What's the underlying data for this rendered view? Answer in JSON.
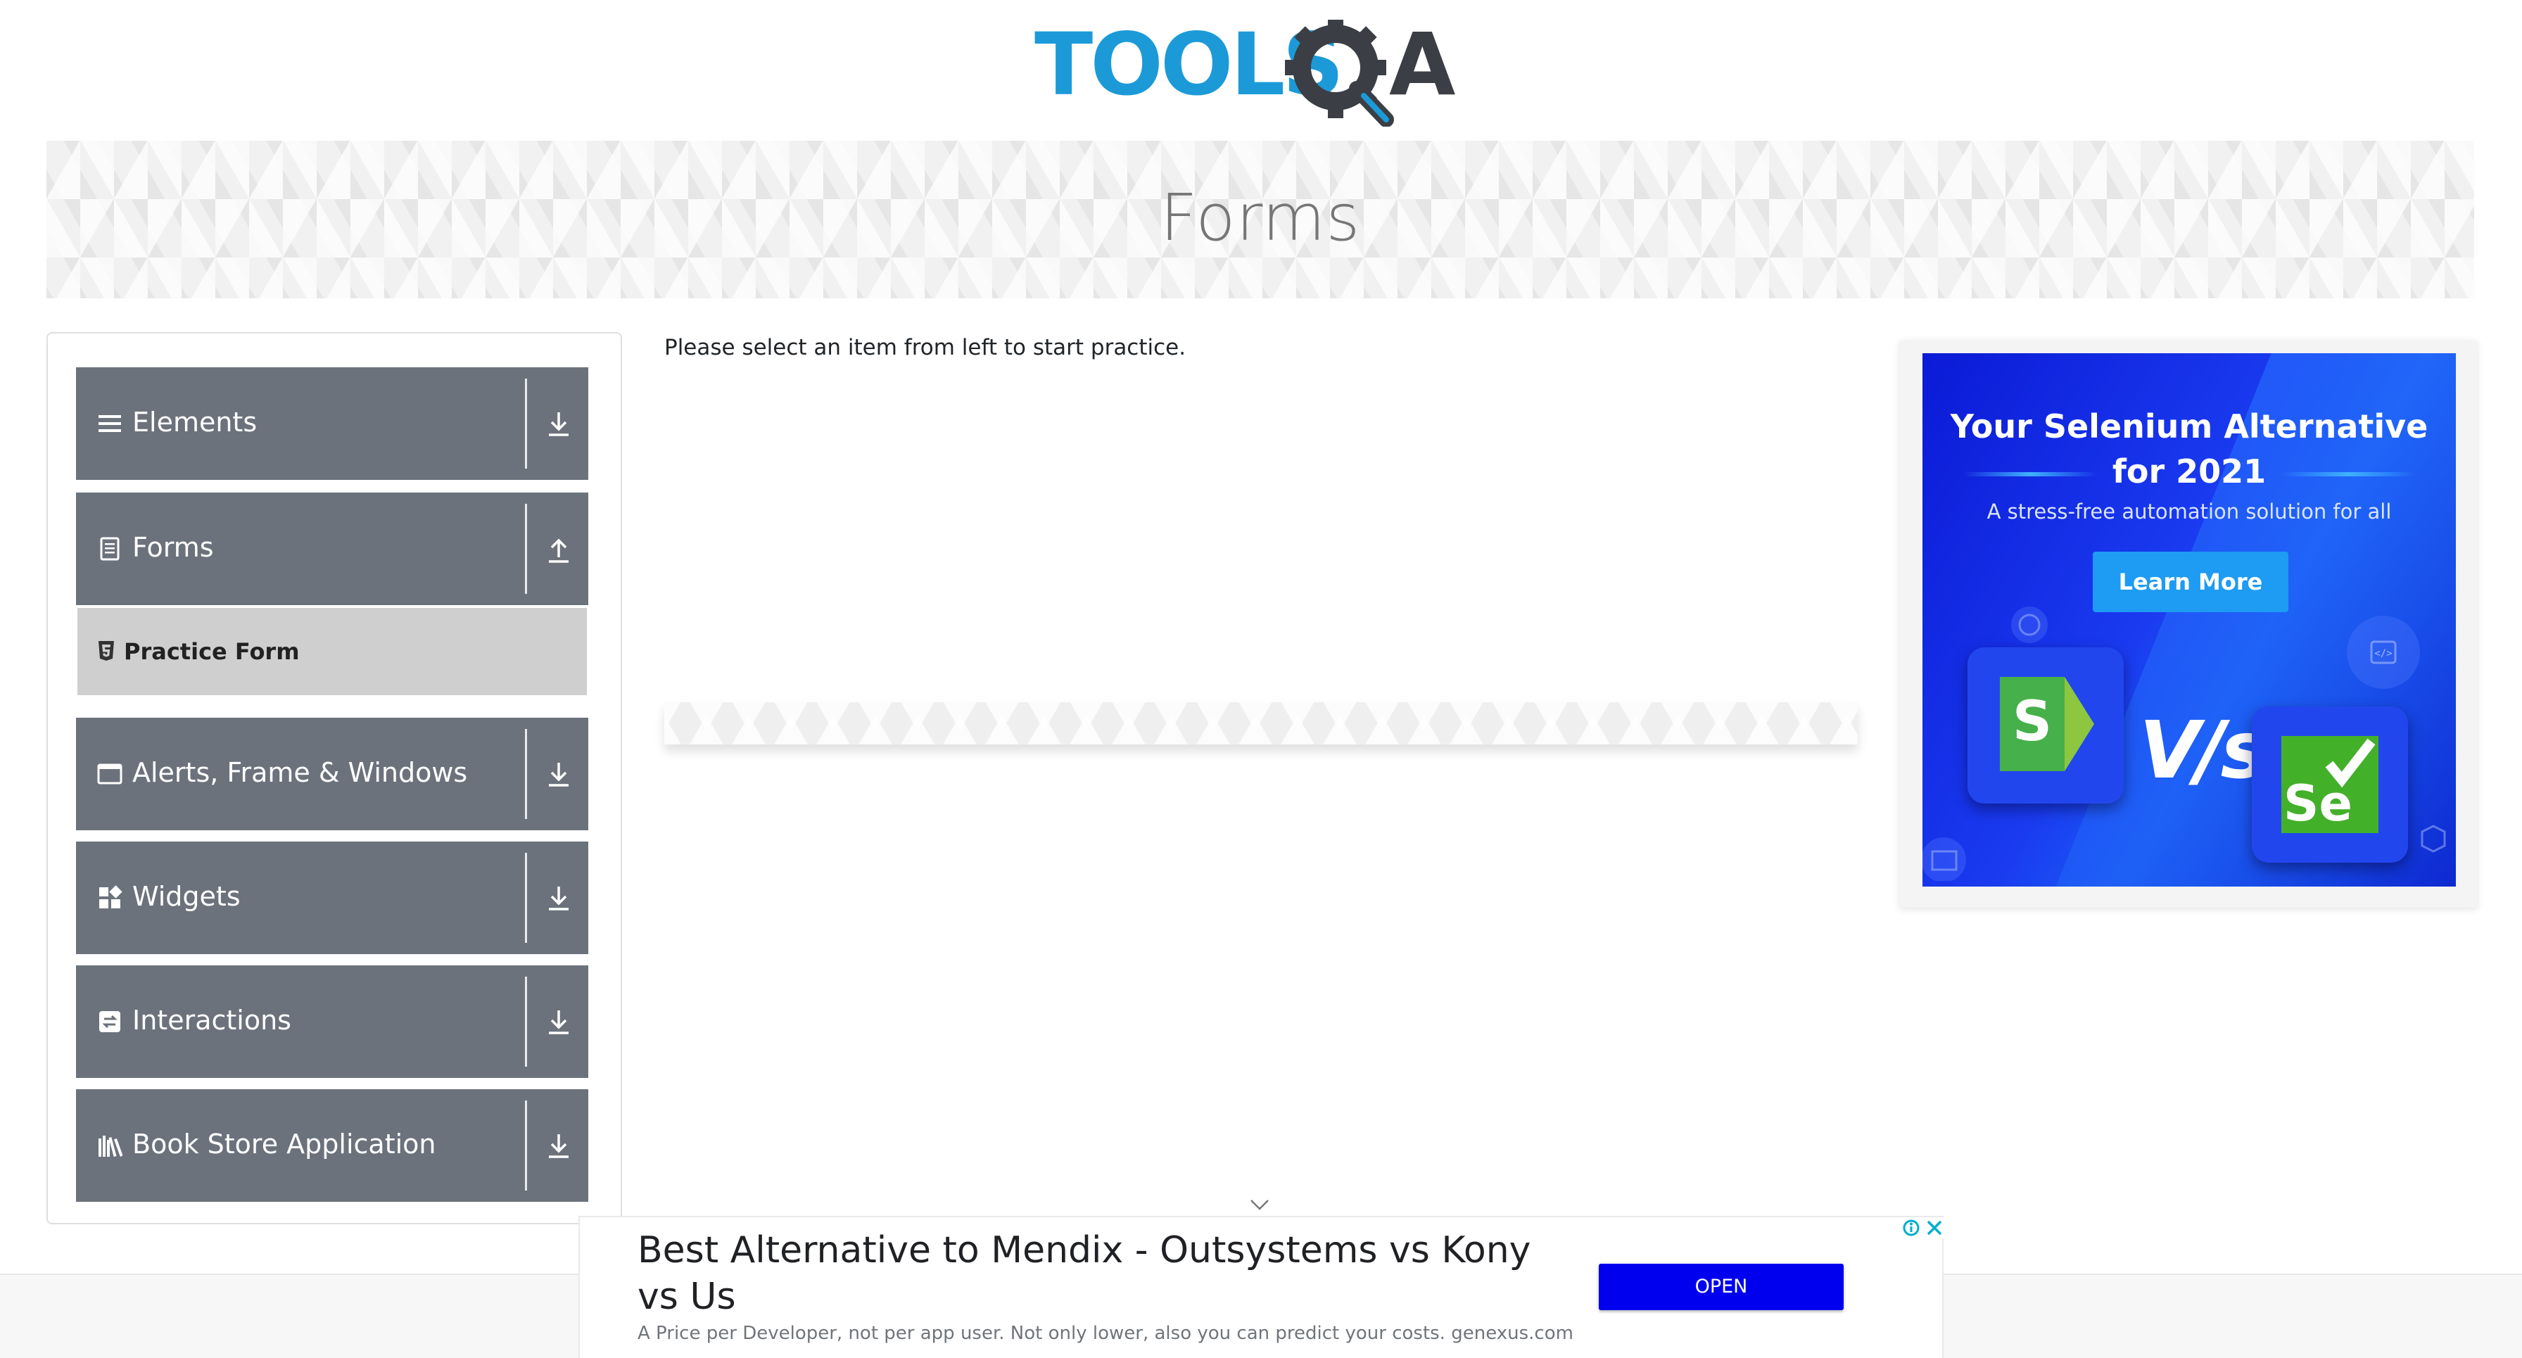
{
  "header": {
    "logo_text_left": "TOOLS",
    "logo_text_right": "QA",
    "brand_blue": "#1c9ad8",
    "brand_dark": "#3b3f45"
  },
  "banner": {
    "title": "Forms"
  },
  "sidebar": {
    "groups": [
      {
        "label": "Elements",
        "icon": "hamburger-icon",
        "arrow": "download-arrow-icon"
      },
      {
        "label": "Forms",
        "icon": "document-icon",
        "arrow": "upload-arrow-icon",
        "expanded": true,
        "items": [
          {
            "label": "Practice Form",
            "icon": "html5-icon",
            "active": true
          }
        ]
      },
      {
        "label": "Alerts, Frame & Windows",
        "icon": "window-icon",
        "arrow": "download-arrow-icon"
      },
      {
        "label": "Widgets",
        "icon": "widgets-icon",
        "arrow": "download-arrow-icon"
      },
      {
        "label": "Interactions",
        "icon": "interactions-icon",
        "arrow": "download-arrow-icon"
      },
      {
        "label": "Book Store Application",
        "icon": "books-icon",
        "arrow": "download-arrow-icon"
      }
    ],
    "header_color": "#6b727c",
    "active_item_color": "#cfcfcf"
  },
  "main": {
    "instructions": "Please select an item from left to start practice."
  },
  "right_ad": {
    "headline_line1": "Your Selenium Alternative",
    "headline_line2": "for 2021",
    "subtext": "A stress-free automation solution for all",
    "button_label": "Learn More",
    "vs_text": "V/s",
    "left_logo_letter": "S",
    "right_logo_letter": "Se"
  },
  "bottom_ad": {
    "title": "Best Alternative to Mendix - Outsystems vs Kony vs Us",
    "description": "A Price per Developer, not per app user. Not only lower, also you can predict your costs. genexus.com",
    "button_label": "OPEN",
    "button_color": "#0000ef"
  }
}
